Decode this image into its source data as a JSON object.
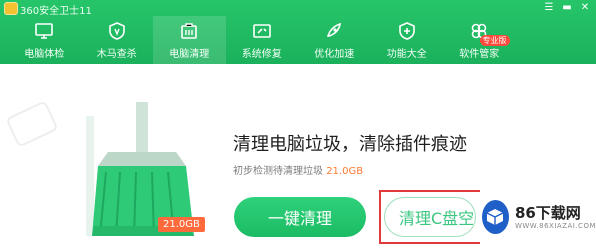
{
  "window": {
    "title": "360安全卫士11",
    "controls": [
      "☰",
      "▬",
      "✕"
    ]
  },
  "nav": {
    "items": [
      {
        "label": "电脑体检",
        "icon": "monitor-icon"
      },
      {
        "label": "木马查杀",
        "icon": "shield-icon"
      },
      {
        "label": "电脑清理",
        "icon": "broom-icon",
        "active": true
      },
      {
        "label": "系统修复",
        "icon": "wrench-icon"
      },
      {
        "label": "优化加速",
        "icon": "rocket-icon"
      },
      {
        "label": "功能大全",
        "icon": "grid-icon"
      },
      {
        "label": "软件管家",
        "icon": "cube-icon",
        "badge": "专业版"
      }
    ]
  },
  "clean": {
    "headline": "清理电脑垃圾，清除插件痕迹",
    "sub_prefix": "初步检测待清理垃圾",
    "sub_value": "21.0GB",
    "size_tag": "21.0GB",
    "primary_button": "一键清理",
    "secondary_button": "清理C盘空间"
  },
  "watermark": {
    "name": "86下载网",
    "url": "WWW.86XIAZAI.COM"
  },
  "colors": {
    "brand_green": "#1bb15c",
    "highlight_orange": "#ff7a33",
    "frame_red": "#e23a3a",
    "watermark_blue": "#1f5fc8"
  }
}
